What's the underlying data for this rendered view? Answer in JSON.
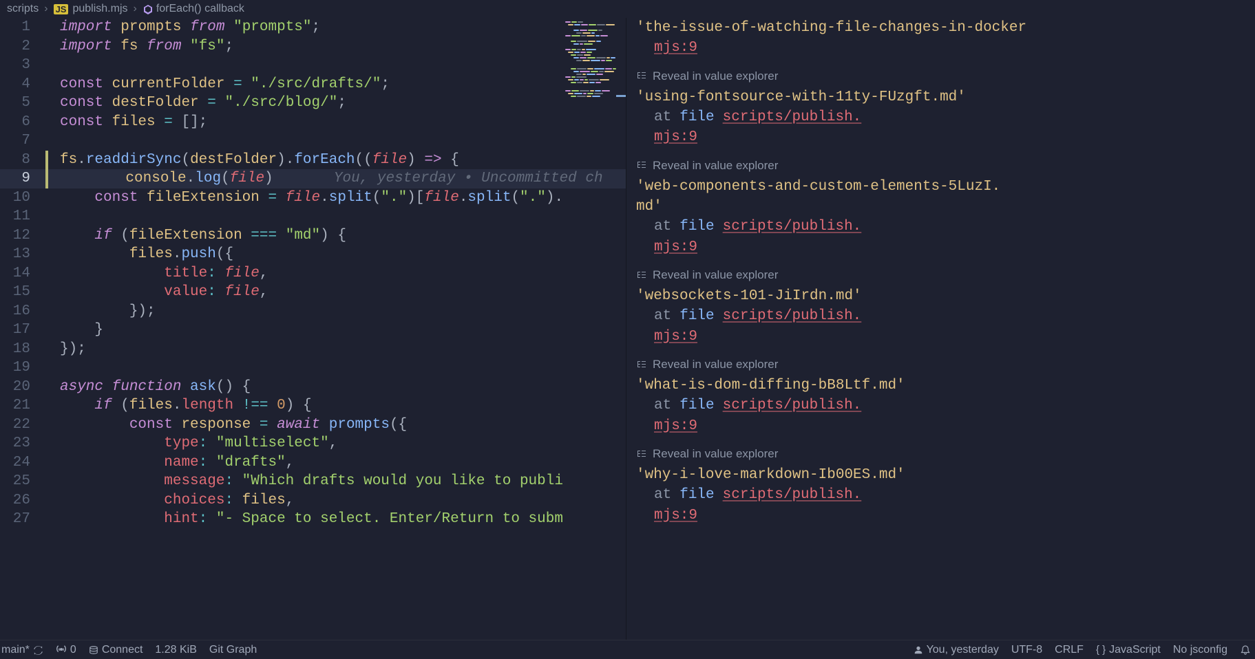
{
  "breadcrumb": {
    "folder": "scripts",
    "file_badge": "JS",
    "file": "publish.mjs",
    "symbol": "forEach() callback"
  },
  "editor": {
    "inline_annotation": "You, yesterday • Uncommitted ch",
    "lines": [
      {
        "n": 1,
        "tokens": [
          [
            "keyword",
            "import"
          ],
          [
            "punct",
            " "
          ],
          [
            "var",
            "prompts"
          ],
          [
            "punct",
            " "
          ],
          [
            "keyword",
            "from"
          ],
          [
            "punct",
            " "
          ],
          [
            "string",
            "\"prompts\""
          ],
          [
            "punct",
            ";"
          ]
        ]
      },
      {
        "n": 2,
        "tokens": [
          [
            "keyword",
            "import"
          ],
          [
            "punct",
            " "
          ],
          [
            "var",
            "fs"
          ],
          [
            "punct",
            " "
          ],
          [
            "keyword",
            "from"
          ],
          [
            "punct",
            " "
          ],
          [
            "string",
            "\"fs\""
          ],
          [
            "punct",
            ";"
          ]
        ]
      },
      {
        "n": 3,
        "tokens": []
      },
      {
        "n": 4,
        "tokens": [
          [
            "keyword-nf",
            "const"
          ],
          [
            "punct",
            " "
          ],
          [
            "var",
            "currentFolder"
          ],
          [
            "punct",
            " "
          ],
          [
            "op",
            "="
          ],
          [
            "punct",
            " "
          ],
          [
            "string",
            "\"./src/drafts/\""
          ],
          [
            "punct",
            ";"
          ]
        ]
      },
      {
        "n": 5,
        "tokens": [
          [
            "keyword-nf",
            "const"
          ],
          [
            "punct",
            " "
          ],
          [
            "var",
            "destFolder"
          ],
          [
            "punct",
            " "
          ],
          [
            "op",
            "="
          ],
          [
            "punct",
            " "
          ],
          [
            "string",
            "\"./src/blog/\""
          ],
          [
            "punct",
            ";"
          ]
        ]
      },
      {
        "n": 6,
        "tokens": [
          [
            "keyword-nf",
            "const"
          ],
          [
            "punct",
            " "
          ],
          [
            "var",
            "files"
          ],
          [
            "punct",
            " "
          ],
          [
            "op",
            "="
          ],
          [
            "punct",
            " []"
          ],
          [
            "punct",
            ";"
          ]
        ]
      },
      {
        "n": 7,
        "tokens": []
      },
      {
        "n": 8,
        "changed": true,
        "tokens": [
          [
            "var",
            "fs"
          ],
          [
            "punct",
            "."
          ],
          [
            "func",
            "readdirSync"
          ],
          [
            "punct",
            "("
          ],
          [
            "var",
            "destFolder"
          ],
          [
            "punct",
            ")."
          ],
          [
            "func",
            "forEach"
          ],
          [
            "punct",
            "(("
          ],
          [
            "param",
            "file"
          ],
          [
            "punct",
            ") "
          ],
          [
            "keyword-nf",
            "=>"
          ],
          [
            "punct",
            " {"
          ]
        ]
      },
      {
        "n": 9,
        "current": true,
        "changed": true,
        "lightbulb": true,
        "tokens": [
          [
            "punct",
            "    "
          ],
          [
            "var",
            "console"
          ],
          [
            "punct",
            "."
          ],
          [
            "func",
            "log"
          ],
          [
            "punct",
            "("
          ],
          [
            "param",
            "file"
          ],
          [
            "punct",
            ")"
          ]
        ],
        "annotation": true
      },
      {
        "n": 10,
        "tokens": [
          [
            "punct",
            "    "
          ],
          [
            "keyword-nf",
            "const"
          ],
          [
            "punct",
            " "
          ],
          [
            "var",
            "fileExtension"
          ],
          [
            "punct",
            " "
          ],
          [
            "op",
            "="
          ],
          [
            "punct",
            " "
          ],
          [
            "param",
            "file"
          ],
          [
            "punct",
            "."
          ],
          [
            "func",
            "split"
          ],
          [
            "punct",
            "("
          ],
          [
            "string",
            "\".\""
          ],
          [
            "punct",
            ")["
          ],
          [
            "param",
            "file"
          ],
          [
            "punct",
            "."
          ],
          [
            "func",
            "split"
          ],
          [
            "punct",
            "("
          ],
          [
            "string",
            "\".\""
          ],
          [
            "punct",
            ")."
          ]
        ]
      },
      {
        "n": 11,
        "tokens": []
      },
      {
        "n": 12,
        "tokens": [
          [
            "punct",
            "    "
          ],
          [
            "keyword",
            "if"
          ],
          [
            "punct",
            " ("
          ],
          [
            "var",
            "fileExtension"
          ],
          [
            "punct",
            " "
          ],
          [
            "op",
            "==="
          ],
          [
            "punct",
            " "
          ],
          [
            "string",
            "\"md\""
          ],
          [
            "punct",
            ") {"
          ]
        ]
      },
      {
        "n": 13,
        "tokens": [
          [
            "punct",
            "        "
          ],
          [
            "var",
            "files"
          ],
          [
            "punct",
            "."
          ],
          [
            "func",
            "push"
          ],
          [
            "punct",
            "({"
          ]
        ]
      },
      {
        "n": 14,
        "tokens": [
          [
            "punct",
            "            "
          ],
          [
            "prop",
            "title"
          ],
          [
            "op",
            ":"
          ],
          [
            "punct",
            " "
          ],
          [
            "param",
            "file"
          ],
          [
            "punct",
            ","
          ]
        ]
      },
      {
        "n": 15,
        "tokens": [
          [
            "punct",
            "            "
          ],
          [
            "prop",
            "value"
          ],
          [
            "op",
            ":"
          ],
          [
            "punct",
            " "
          ],
          [
            "param",
            "file"
          ],
          [
            "punct",
            ","
          ]
        ]
      },
      {
        "n": 16,
        "tokens": [
          [
            "punct",
            "        });"
          ]
        ]
      },
      {
        "n": 17,
        "tokens": [
          [
            "punct",
            "    }"
          ]
        ]
      },
      {
        "n": 18,
        "tokens": [
          [
            "punct",
            "});"
          ]
        ]
      },
      {
        "n": 19,
        "tokens": []
      },
      {
        "n": 20,
        "tokens": [
          [
            "keyword",
            "async function"
          ],
          [
            "punct",
            " "
          ],
          [
            "func",
            "ask"
          ],
          [
            "punct",
            "() {"
          ]
        ]
      },
      {
        "n": 21,
        "tokens": [
          [
            "punct",
            "    "
          ],
          [
            "keyword",
            "if"
          ],
          [
            "punct",
            " ("
          ],
          [
            "var",
            "files"
          ],
          [
            "punct",
            "."
          ],
          [
            "prop",
            "length"
          ],
          [
            "punct",
            " "
          ],
          [
            "op",
            "!=="
          ],
          [
            "punct",
            " "
          ],
          [
            "num",
            "0"
          ],
          [
            "punct",
            ") {"
          ]
        ]
      },
      {
        "n": 22,
        "tokens": [
          [
            "punct",
            "        "
          ],
          [
            "keyword-nf",
            "const"
          ],
          [
            "punct",
            " "
          ],
          [
            "var",
            "response"
          ],
          [
            "punct",
            " "
          ],
          [
            "op",
            "="
          ],
          [
            "punct",
            " "
          ],
          [
            "keyword",
            "await"
          ],
          [
            "punct",
            " "
          ],
          [
            "func",
            "prompts"
          ],
          [
            "punct",
            "({"
          ]
        ]
      },
      {
        "n": 23,
        "tokens": [
          [
            "punct",
            "            "
          ],
          [
            "prop",
            "type"
          ],
          [
            "op",
            ":"
          ],
          [
            "punct",
            " "
          ],
          [
            "string",
            "\"multiselect\""
          ],
          [
            "punct",
            ","
          ]
        ]
      },
      {
        "n": 24,
        "tokens": [
          [
            "punct",
            "            "
          ],
          [
            "prop",
            "name"
          ],
          [
            "op",
            ":"
          ],
          [
            "punct",
            " "
          ],
          [
            "string",
            "\"drafts\""
          ],
          [
            "punct",
            ","
          ]
        ]
      },
      {
        "n": 25,
        "tokens": [
          [
            "punct",
            "            "
          ],
          [
            "prop",
            "message"
          ],
          [
            "op",
            ":"
          ],
          [
            "punct",
            " "
          ],
          [
            "string",
            "\"Which drafts would you like to publi"
          ]
        ]
      },
      {
        "n": 26,
        "tokens": [
          [
            "punct",
            "            "
          ],
          [
            "prop",
            "choices"
          ],
          [
            "op",
            ":"
          ],
          [
            "punct",
            " "
          ],
          [
            "var",
            "files"
          ],
          [
            "punct",
            ","
          ]
        ]
      },
      {
        "n": 27,
        "tokens": [
          [
            "punct",
            "            "
          ],
          [
            "prop",
            "hint"
          ],
          [
            "op",
            ":"
          ],
          [
            "punct",
            " "
          ],
          [
            "string",
            "\"- Space to select. Enter/Return to subm"
          ]
        ]
      }
    ]
  },
  "output": {
    "reveal_label": "Reveal in value explorer",
    "at_word": "at",
    "file_word": "file",
    "link_part1": "scripts/publish.",
    "link_part2": "mjs:9",
    "entries": [
      {
        "str": "'the-issue-of-watching-file-changes-in-docker",
        "cont_link": true,
        "no_reveal": true
      },
      {
        "str": "'using-fontsource-with-11ty-FUzgft.md'"
      },
      {
        "str": "'web-components-and-custom-elements-5LuzI.md'",
        "wrap": true
      },
      {
        "str": "'websockets-101-JiIrdn.md'"
      },
      {
        "str": "'what-is-dom-diffing-bB8Ltf.md'"
      },
      {
        "str": "'why-i-love-markdown-Ib00ES.md'"
      }
    ]
  },
  "status": {
    "branch": "main*",
    "broadcast": "0",
    "connect": "Connect",
    "size": "1.28 KiB",
    "git_graph": "Git Graph",
    "blame": "You, yesterday",
    "encoding": "UTF-8",
    "eol": "CRLF",
    "lang": "JavaScript",
    "jsconfig": "No jsconfig"
  }
}
